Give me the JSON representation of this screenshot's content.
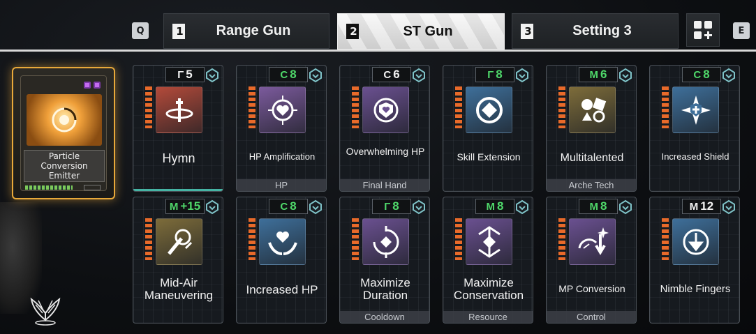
{
  "tabs": {
    "prev_key": "Q",
    "next_key": "E",
    "items": [
      {
        "num": "1",
        "label": "Range Gun",
        "active": false
      },
      {
        "num": "2",
        "label": "ST Gun",
        "active": true
      },
      {
        "num": "3",
        "label": "Setting 3",
        "active": false
      }
    ],
    "add_icon": "grid-plus-icon"
  },
  "equipment": {
    "name": "Particle Conversion Emitter",
    "accent": "#e9a93a"
  },
  "modules": [
    {
      "cost_type": "rutile",
      "cost_symbol": "Γ",
      "cost": "5",
      "cost_color": "#f2f2f2",
      "title": "Hymn",
      "tag": "",
      "icon_color": "#b34a3a",
      "icon": "hymn-icon"
    },
    {
      "cost_type": "cerulean",
      "cost_symbol": "C",
      "cost": "8",
      "cost_color": "#4fd86a",
      "title": "HP Amplification",
      "tag": "HP",
      "icon_color": "#7b5a9c",
      "icon": "heart-sun-icon"
    },
    {
      "cost_type": "cerulean",
      "cost_symbol": "C",
      "cost": "6",
      "cost_color": "#f2f2f2",
      "title": "Overwhelming HP",
      "tag": "Final Hand",
      "icon_color": "#6a5090",
      "icon": "heart-shield-icon"
    },
    {
      "cost_type": "rutile",
      "cost_symbol": "Γ",
      "cost": "8",
      "cost_color": "#4fd86a",
      "title": "Skill Extension",
      "tag": "",
      "icon_color": "#3e6f9a",
      "icon": "diamond-ring-icon"
    },
    {
      "cost_type": "malachite",
      "cost_symbol": "M",
      "cost": "6",
      "cost_color": "#4fd86a",
      "title": "Multitalented",
      "tag": "Arche Tech",
      "icon_color": "#7d6c3a",
      "icon": "multi-icon"
    },
    {
      "cost_type": "cerulean",
      "cost_symbol": "C",
      "cost": "8",
      "cost_color": "#4fd86a",
      "title": "Increased Shield",
      "tag": "",
      "icon_color": "#3e6f9a",
      "icon": "shield-cross-icon"
    },
    {
      "cost_type": "malachite",
      "cost_symbol": "M",
      "cost": "+15",
      "cost_color": "#4fd86a",
      "title": "Mid-Air Maneuvering",
      "tag": "",
      "icon_color": "#7d6c3a",
      "icon": "grapple-icon"
    },
    {
      "cost_type": "cerulean",
      "cost_symbol": "C",
      "cost": "8",
      "cost_color": "#4fd86a",
      "title": "Increased HP",
      "tag": "",
      "icon_color": "#3e6f9a",
      "icon": "heart-hands-icon"
    },
    {
      "cost_type": "rutile",
      "cost_symbol": "Γ",
      "cost": "8",
      "cost_color": "#4fd86a",
      "title": "Maximize Duration",
      "tag": "Cooldown",
      "icon_color": "#6a5090",
      "icon": "cycle-diamond-icon"
    },
    {
      "cost_type": "malachite",
      "cost_symbol": "M",
      "cost": "8",
      "cost_color": "#4fd86a",
      "title": "Maximize Conservation",
      "tag": "Resource",
      "icon_color": "#6a5090",
      "icon": "conserve-icon"
    },
    {
      "cost_type": "malachite",
      "cost_symbol": "M",
      "cost": "8",
      "cost_color": "#4fd86a",
      "title": "MP Conversion",
      "tag": "Control",
      "icon_color": "#6a5090",
      "icon": "gauge-arrow-icon"
    },
    {
      "cost_type": "malachite",
      "cost_symbol": "M",
      "cost": "12",
      "cost_color": "#f2f2f2",
      "title": "Nimble Fingers",
      "tag": "",
      "icon_color": "#3e6f9a",
      "icon": "clock-arrow-icon"
    }
  ]
}
